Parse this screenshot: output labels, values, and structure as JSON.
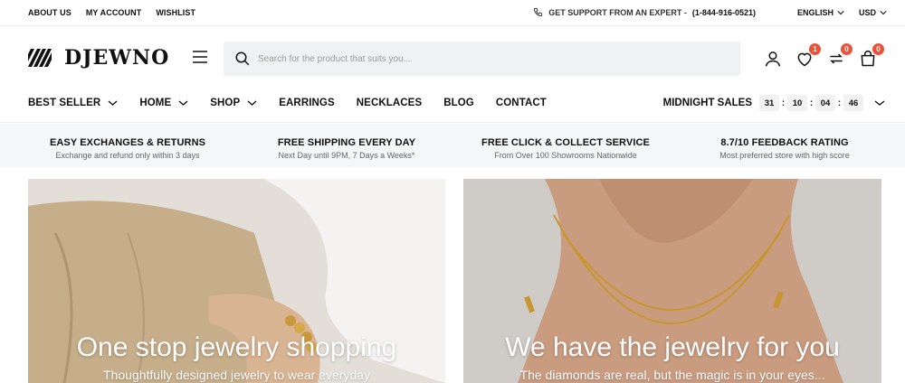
{
  "topbar": {
    "links": [
      "ABOUT US",
      "MY ACCOUNT",
      "WISHLIST"
    ],
    "support_text": "GET SUPPORT FROM AN EXPERT -",
    "support_phone": "(1-844-916-0521)",
    "language": "ENGLISH",
    "currency": "USD"
  },
  "header": {
    "logo": "DJEWNO",
    "search_placeholder": "Search for the product that suits you...",
    "wishlist_count": "1",
    "compare_count": "0",
    "cart_count": "0"
  },
  "nav": {
    "items": [
      {
        "label": "BEST SELLER",
        "dropdown": true
      },
      {
        "label": "HOME",
        "dropdown": true
      },
      {
        "label": "SHOP",
        "dropdown": true
      },
      {
        "label": "EARRINGS",
        "dropdown": false
      },
      {
        "label": "NECKLACES",
        "dropdown": false
      },
      {
        "label": "BLOG",
        "dropdown": false
      },
      {
        "label": "CONTACT",
        "dropdown": false
      }
    ],
    "sales_label": "MIDNIGHT SALES",
    "timer": [
      "31",
      "10",
      "04",
      "46"
    ]
  },
  "features": [
    {
      "title": "EASY EXCHANGES & RETURNS",
      "subtitle": "Exchange and refund only within 3 days"
    },
    {
      "title": "FREE SHIPPING EVERY DAY",
      "subtitle": "Next Day until 9PM, 7 Days a Weeks*"
    },
    {
      "title": "FREE CLICK & COLLECT SERVICE",
      "subtitle": "From Over 100 Showrooms Nationwide"
    },
    {
      "title": "8.7/10 FEEDBACK RATING",
      "subtitle": "Most preferred store with high score"
    }
  ],
  "banners": [
    {
      "title": "One stop jewelry shopping",
      "subtitle": "Thoughtfully designed jewelry to wear everyday"
    },
    {
      "title": "We have the jewelry for you",
      "subtitle": "The diamonds are real, but the magic is in your eyes..."
    }
  ],
  "colors": {
    "accent": "#e8533a",
    "search_bg": "#f0f1f2",
    "strip_bg": "#f5f6f7"
  }
}
